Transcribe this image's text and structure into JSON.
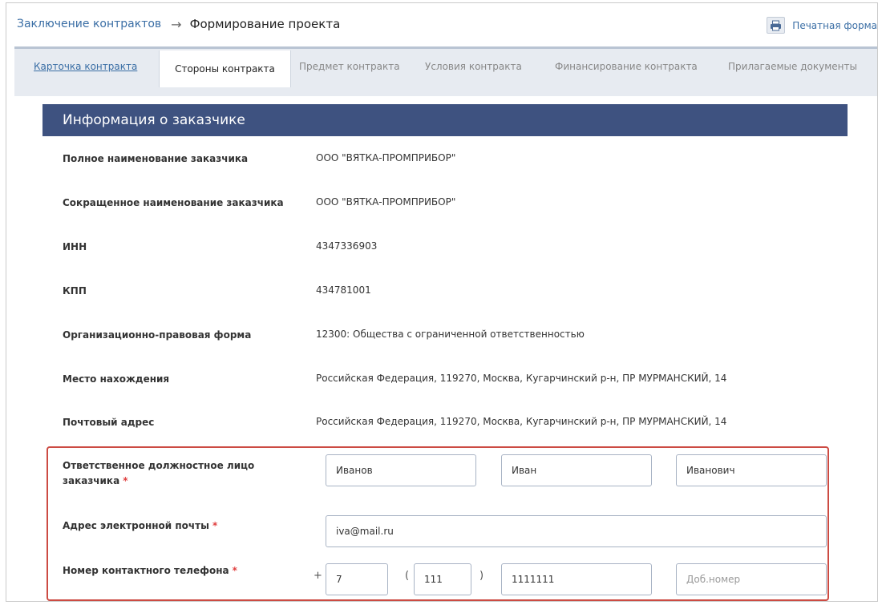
{
  "breadcrumb": {
    "parent": "Заключение контрактов",
    "arrow": "→",
    "current": "Формирование проекта"
  },
  "print": {
    "label": "Печатная форма"
  },
  "tabs": [
    {
      "label": "Карточка контракта",
      "state": "link"
    },
    {
      "label": "Стороны контракта",
      "state": "active"
    },
    {
      "label": "Предмет контракта",
      "state": "inactive"
    },
    {
      "label": "Условия контракта",
      "state": "inactive"
    },
    {
      "label": "Финансирование контракта",
      "state": "inactive"
    },
    {
      "label": "Прилагаемые документы",
      "state": "inactive"
    }
  ],
  "section": {
    "title": "Информация о заказчике"
  },
  "fields": [
    {
      "label": "Полное наименование заказчика",
      "value": "ООО \"ВЯТКА-ПРОМПРИБОР\""
    },
    {
      "label": "Сокращенное наименование заказчика",
      "value": "ООО \"ВЯТКА-ПРОМПРИБОР\""
    },
    {
      "label": "ИНН",
      "value": "4347336903"
    },
    {
      "label": "КПП",
      "value": "434781001"
    },
    {
      "label": "Организационно-правовая форма",
      "value": "12300: Общества с ограниченной ответственностью"
    },
    {
      "label": "Место нахождения",
      "value": "Российская Федерация, 119270, Москва, Кугарчинский р-н, ПР МУРМАНСКИЙ, 14"
    },
    {
      "label": "Почтовый адрес",
      "value": "Российская Федерация, 119270, Москва, Кугарчинский р-н, ПР МУРМАНСКИЙ, 14"
    }
  ],
  "required_mark": "*",
  "responsible": {
    "label": "Ответственное должностное лицо заказчика",
    "last_name": "Иванов",
    "first_name": "Иван",
    "middle_name": "Иванович"
  },
  "email": {
    "label": "Адрес электронной почты",
    "value": "iva@mail.ru"
  },
  "phone": {
    "label": "Номер контактного телефона",
    "plus": "+",
    "country_code": "7",
    "open_paren": "(",
    "area_code": "111",
    "close_paren": ")",
    "number": "1111111",
    "extension_placeholder": "Доб.номер"
  },
  "colors": {
    "header_bg": "#3e5280",
    "link": "#3a6ea5",
    "required": "#e04040",
    "highlight_border": "#cc4b43"
  }
}
